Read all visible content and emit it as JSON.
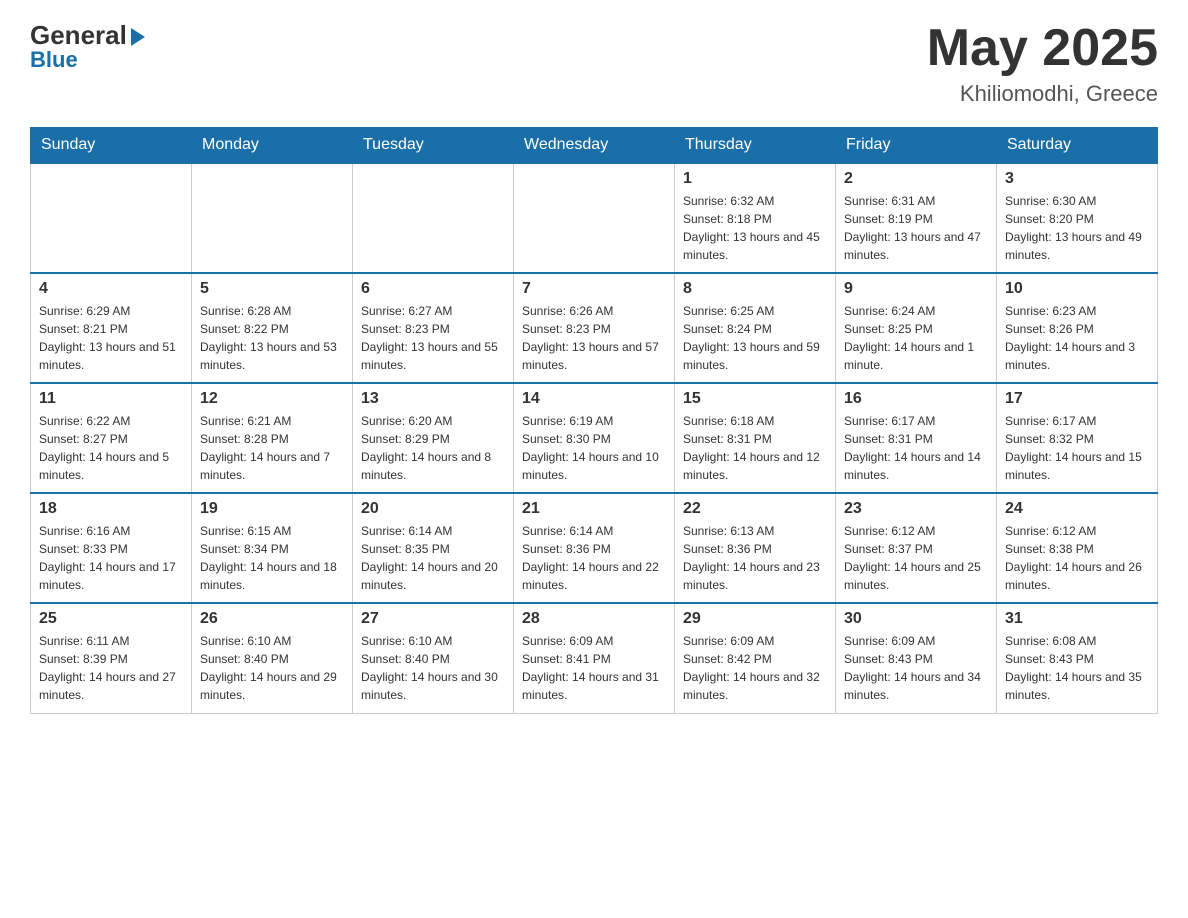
{
  "header": {
    "logo_general": "General",
    "logo_blue": "Blue",
    "month_year": "May 2025",
    "location": "Khiliomodhi, Greece"
  },
  "days_of_week": [
    "Sunday",
    "Monday",
    "Tuesday",
    "Wednesday",
    "Thursday",
    "Friday",
    "Saturday"
  ],
  "weeks": [
    [
      {
        "day": "",
        "info": ""
      },
      {
        "day": "",
        "info": ""
      },
      {
        "day": "",
        "info": ""
      },
      {
        "day": "",
        "info": ""
      },
      {
        "day": "1",
        "info": "Sunrise: 6:32 AM\nSunset: 8:18 PM\nDaylight: 13 hours and 45 minutes."
      },
      {
        "day": "2",
        "info": "Sunrise: 6:31 AM\nSunset: 8:19 PM\nDaylight: 13 hours and 47 minutes."
      },
      {
        "day": "3",
        "info": "Sunrise: 6:30 AM\nSunset: 8:20 PM\nDaylight: 13 hours and 49 minutes."
      }
    ],
    [
      {
        "day": "4",
        "info": "Sunrise: 6:29 AM\nSunset: 8:21 PM\nDaylight: 13 hours and 51 minutes."
      },
      {
        "day": "5",
        "info": "Sunrise: 6:28 AM\nSunset: 8:22 PM\nDaylight: 13 hours and 53 minutes."
      },
      {
        "day": "6",
        "info": "Sunrise: 6:27 AM\nSunset: 8:23 PM\nDaylight: 13 hours and 55 minutes."
      },
      {
        "day": "7",
        "info": "Sunrise: 6:26 AM\nSunset: 8:23 PM\nDaylight: 13 hours and 57 minutes."
      },
      {
        "day": "8",
        "info": "Sunrise: 6:25 AM\nSunset: 8:24 PM\nDaylight: 13 hours and 59 minutes."
      },
      {
        "day": "9",
        "info": "Sunrise: 6:24 AM\nSunset: 8:25 PM\nDaylight: 14 hours and 1 minute."
      },
      {
        "day": "10",
        "info": "Sunrise: 6:23 AM\nSunset: 8:26 PM\nDaylight: 14 hours and 3 minutes."
      }
    ],
    [
      {
        "day": "11",
        "info": "Sunrise: 6:22 AM\nSunset: 8:27 PM\nDaylight: 14 hours and 5 minutes."
      },
      {
        "day": "12",
        "info": "Sunrise: 6:21 AM\nSunset: 8:28 PM\nDaylight: 14 hours and 7 minutes."
      },
      {
        "day": "13",
        "info": "Sunrise: 6:20 AM\nSunset: 8:29 PM\nDaylight: 14 hours and 8 minutes."
      },
      {
        "day": "14",
        "info": "Sunrise: 6:19 AM\nSunset: 8:30 PM\nDaylight: 14 hours and 10 minutes."
      },
      {
        "day": "15",
        "info": "Sunrise: 6:18 AM\nSunset: 8:31 PM\nDaylight: 14 hours and 12 minutes."
      },
      {
        "day": "16",
        "info": "Sunrise: 6:17 AM\nSunset: 8:31 PM\nDaylight: 14 hours and 14 minutes."
      },
      {
        "day": "17",
        "info": "Sunrise: 6:17 AM\nSunset: 8:32 PM\nDaylight: 14 hours and 15 minutes."
      }
    ],
    [
      {
        "day": "18",
        "info": "Sunrise: 6:16 AM\nSunset: 8:33 PM\nDaylight: 14 hours and 17 minutes."
      },
      {
        "day": "19",
        "info": "Sunrise: 6:15 AM\nSunset: 8:34 PM\nDaylight: 14 hours and 18 minutes."
      },
      {
        "day": "20",
        "info": "Sunrise: 6:14 AM\nSunset: 8:35 PM\nDaylight: 14 hours and 20 minutes."
      },
      {
        "day": "21",
        "info": "Sunrise: 6:14 AM\nSunset: 8:36 PM\nDaylight: 14 hours and 22 minutes."
      },
      {
        "day": "22",
        "info": "Sunrise: 6:13 AM\nSunset: 8:36 PM\nDaylight: 14 hours and 23 minutes."
      },
      {
        "day": "23",
        "info": "Sunrise: 6:12 AM\nSunset: 8:37 PM\nDaylight: 14 hours and 25 minutes."
      },
      {
        "day": "24",
        "info": "Sunrise: 6:12 AM\nSunset: 8:38 PM\nDaylight: 14 hours and 26 minutes."
      }
    ],
    [
      {
        "day": "25",
        "info": "Sunrise: 6:11 AM\nSunset: 8:39 PM\nDaylight: 14 hours and 27 minutes."
      },
      {
        "day": "26",
        "info": "Sunrise: 6:10 AM\nSunset: 8:40 PM\nDaylight: 14 hours and 29 minutes."
      },
      {
        "day": "27",
        "info": "Sunrise: 6:10 AM\nSunset: 8:40 PM\nDaylight: 14 hours and 30 minutes."
      },
      {
        "day": "28",
        "info": "Sunrise: 6:09 AM\nSunset: 8:41 PM\nDaylight: 14 hours and 31 minutes."
      },
      {
        "day": "29",
        "info": "Sunrise: 6:09 AM\nSunset: 8:42 PM\nDaylight: 14 hours and 32 minutes."
      },
      {
        "day": "30",
        "info": "Sunrise: 6:09 AM\nSunset: 8:43 PM\nDaylight: 14 hours and 34 minutes."
      },
      {
        "day": "31",
        "info": "Sunrise: 6:08 AM\nSunset: 8:43 PM\nDaylight: 14 hours and 35 minutes."
      }
    ]
  ]
}
